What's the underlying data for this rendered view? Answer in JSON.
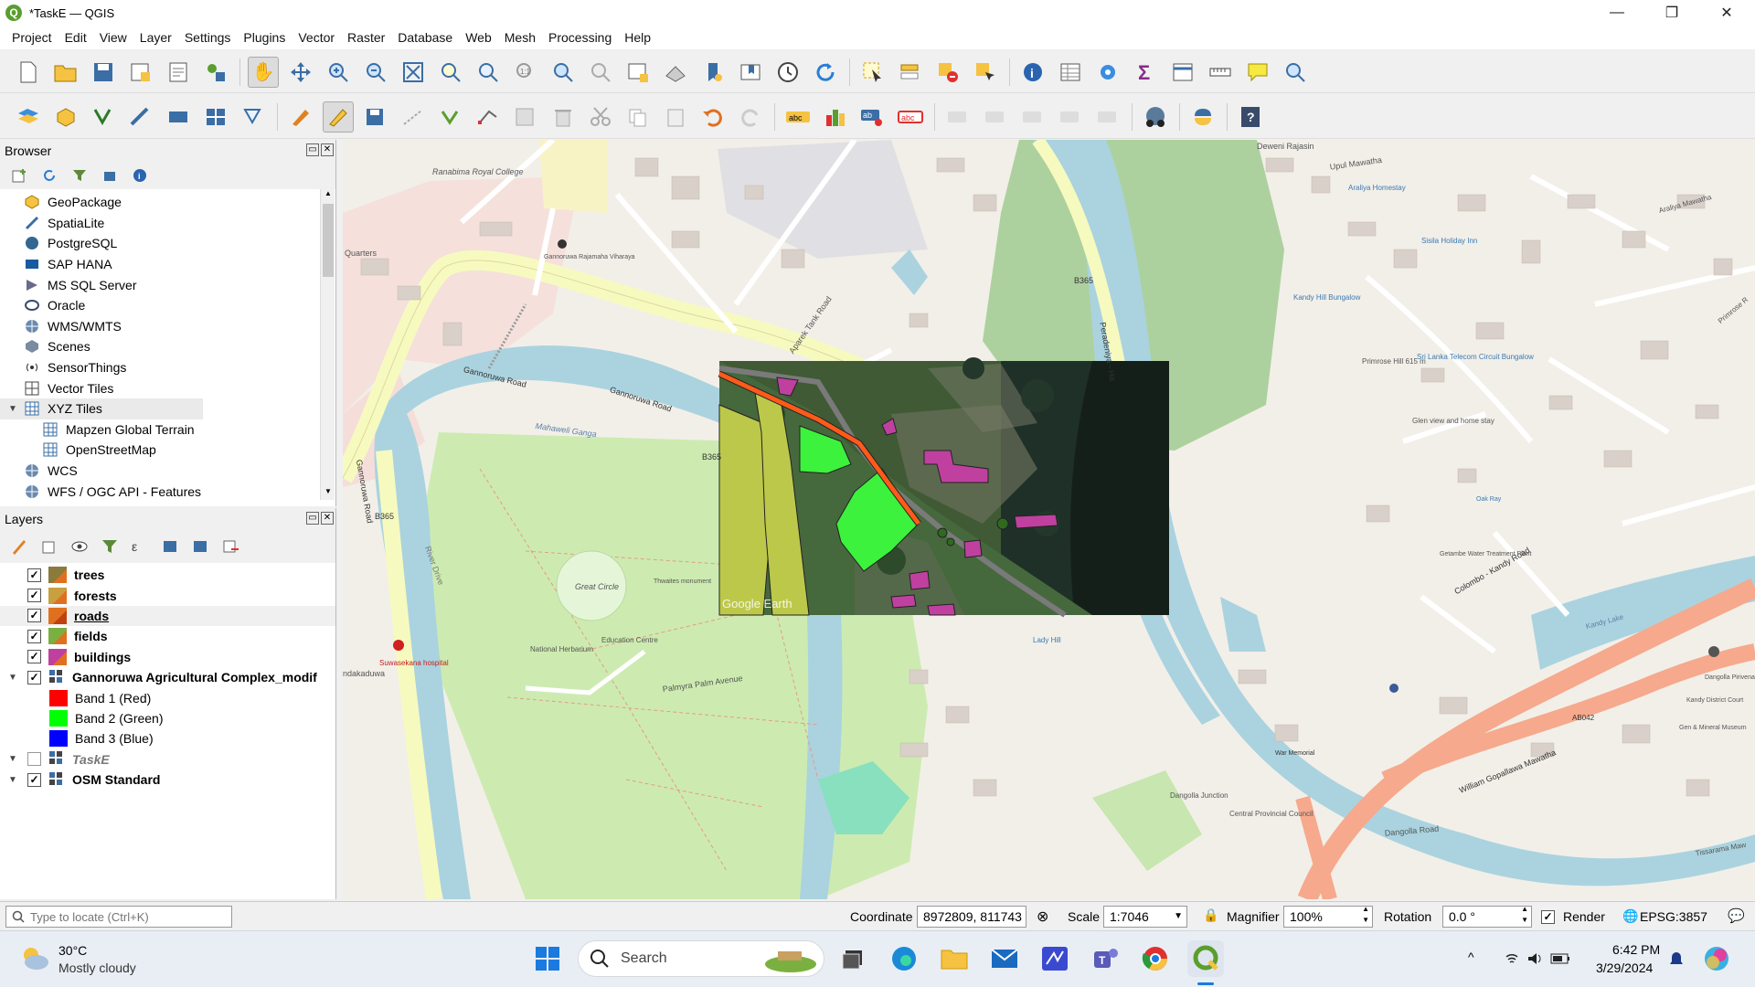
{
  "window": {
    "title": "*TaskE — QGIS",
    "app_icon": "qgis-logo-icon",
    "minimize": "—",
    "maximize": "❐",
    "close": "✕"
  },
  "menu": [
    "Project",
    "Edit",
    "View",
    "Layer",
    "Settings",
    "Plugins",
    "Vector",
    "Raster",
    "Database",
    "Web",
    "Mesh",
    "Processing",
    "Help"
  ],
  "toolbar1": [
    "new-project-icon",
    "open-project-icon",
    "save-project-icon",
    "new-print-layout-icon",
    "layout-manager-icon",
    "style-manager-icon",
    "pan-map-icon",
    "pan-to-selection-icon",
    "zoom-in-icon",
    "zoom-out-icon",
    "zoom-full-icon",
    "zoom-to-selection-icon",
    "zoom-to-layer-icon",
    "zoom-native-icon",
    "zoom-last-icon",
    "zoom-next-icon",
    "new-map-view-icon",
    "new-3d-map-view-icon",
    "new-bookmark-icon",
    "show-bookmarks-icon",
    "temporal-controller-icon",
    "refresh-icon",
    "select-features-icon",
    "select-by-value-icon",
    "deselect-icon",
    "select-by-location-icon",
    "identify-icon",
    "attribute-table-icon",
    "processing-toolbox-icon",
    "statistics-icon",
    "open-field-calculator-icon",
    "measure-icon",
    "map-tips-icon",
    "locate-icon"
  ],
  "toolbar2": [
    "data-source-manager-icon",
    "new-geopackage-layer-icon",
    "new-shapefile-layer-icon",
    "new-spatialite-layer-icon",
    "new-temporary-layer-icon",
    "new-virtual-layer-icon",
    "digitize-icon",
    "toggle-editing-icon",
    "save-edits-icon",
    "add-feature-icon",
    "vertex-tool-icon",
    "modify-attributes-icon",
    "delete-selected-icon",
    "cut-features-icon",
    "copy-features-icon",
    "paste-features-icon",
    "undo-icon",
    "redo-icon",
    "label-tool-icon",
    "diagram-tool-icon",
    "pin-labels-icon",
    "highlight-labels-icon",
    "show-hide-labels-icon",
    "move-label-icon",
    "rotate-label-icon",
    "change-label-icon",
    "quickmapservices-icon",
    "python-console-icon",
    "help-icon"
  ],
  "browser": {
    "title": "Browser",
    "items": [
      {
        "label": "GeoPackage",
        "icon": "geopackage-icon",
        "indent": 1
      },
      {
        "label": "SpatiaLite",
        "icon": "spatialite-icon",
        "indent": 1
      },
      {
        "label": "PostgreSQL",
        "icon": "postgresql-icon",
        "indent": 1
      },
      {
        "label": "SAP HANA",
        "icon": "sap-hana-icon",
        "indent": 1
      },
      {
        "label": "MS SQL Server",
        "icon": "mssql-icon",
        "indent": 1
      },
      {
        "label": "Oracle",
        "icon": "oracle-icon",
        "indent": 1
      },
      {
        "label": "WMS/WMTS",
        "icon": "wms-icon",
        "indent": 1
      },
      {
        "label": "Scenes",
        "icon": "scenes-icon",
        "indent": 1
      },
      {
        "label": "SensorThings",
        "icon": "sensorthings-icon",
        "indent": 1
      },
      {
        "label": "Vector Tiles",
        "icon": "vector-tiles-icon",
        "indent": 1
      },
      {
        "label": "XYZ Tiles",
        "icon": "xyz-tiles-icon",
        "indent": 1,
        "expanded": true
      },
      {
        "label": "Mapzen Global Terrain",
        "icon": "tile-grid-icon",
        "indent": 2
      },
      {
        "label": "OpenStreetMap",
        "icon": "tile-grid-icon",
        "indent": 2
      },
      {
        "label": "WCS",
        "icon": "wcs-icon",
        "indent": 1
      },
      {
        "label": "WFS / OGC API - Features",
        "icon": "wfs-icon",
        "indent": 1
      }
    ]
  },
  "layers": {
    "title": "Layers",
    "items": [
      {
        "label": "trees",
        "checked": true,
        "bold": true,
        "swatch": "#8a7a3c",
        "indent": 1
      },
      {
        "label": "forests",
        "checked": true,
        "bold": true,
        "swatch": "#c8a040",
        "indent": 1
      },
      {
        "label": "roads",
        "checked": true,
        "bold": true,
        "underline": true,
        "swatch": "#e07020",
        "indent": 1
      },
      {
        "label": "fields",
        "checked": true,
        "bold": true,
        "swatch": "#7ab040",
        "indent": 1
      },
      {
        "label": "buildings",
        "checked": true,
        "bold": true,
        "swatch": "#c040a0",
        "indent": 1
      },
      {
        "label": "Gannoruwa Agricultural Complex_modif",
        "checked": true,
        "bold": true,
        "raster": true,
        "expanded": true,
        "indent": 0
      },
      {
        "label": "Band 1 (Red)",
        "band": "#ff0000",
        "indent": 2
      },
      {
        "label": "Band 2 (Green)",
        "band": "#00ff00",
        "indent": 2
      },
      {
        "label": "Band 3 (Blue)",
        "band": "#0000ff",
        "indent": 2
      },
      {
        "label": "TaskE",
        "checked": false,
        "bold": true,
        "italic": true,
        "raster": true,
        "expanded": true,
        "indent": 0
      },
      {
        "label": "OSM Standard",
        "checked": true,
        "bold": true,
        "raster": true,
        "expanded": true,
        "indent": 0
      }
    ]
  },
  "locator": {
    "placeholder": "Type to locate (Ctrl+K)"
  },
  "status": {
    "coordinate_label": "Coordinate",
    "coordinate": "8972809, 811743",
    "scale_label": "Scale",
    "scale": "1:7046",
    "magnifier_label": "Magnifier",
    "magnifier": "100%",
    "rotation_label": "Rotation",
    "rotation": "0.0 °",
    "render_label": "Render",
    "crs": "EPSG:3857"
  },
  "map": {
    "labels": {
      "ranabima": "Ranabima Royal College",
      "quarters": "Quarters",
      "vihara": "Gannoruwa Rajamaha Viharaya",
      "gannoruwa_road1": "Gannoruwa Road",
      "gannoruwa_road2": "Gannoruwa Road",
      "gannoruwa_road3": "Gannoruwa Road",
      "mahaweli": "Mahaweli Ganga",
      "river_drive": "River Drive",
      "great_circle": "Great Circle",
      "thwaites": "Thwaites monument",
      "national_herbarium": "National Herbarium",
      "education": "Education Centre",
      "palmyra": "Palmyra Palm Avenue",
      "suwasekana": "Suwasekana hospital",
      "ndakaduwa": "ndakaduwa",
      "b365a": "B365",
      "b365b": "B365",
      "b365c": "B365",
      "peradeniya": "Peradeniya - Ha",
      "aparek": "Aparek Tank Road",
      "upul": "Upul Mawatha",
      "deweni": "Deweni Rajasin",
      "araliya": "Araliya Homestay",
      "sisila": "Sisila Holiday Inn",
      "kandy_hill": "Kandy Hill Bungalow",
      "primrose": "Primrose Hill 615 m",
      "srilanka_telecom": "Sri Lanka Telecom Circuit Bungalow",
      "glen": "Glen view and home stay",
      "colombo_kandy": "Colombo - Kandy Road",
      "william": "William Gopallawa Mawatha",
      "dangolla_junction": "Dangolla Junction",
      "dangolla_road": "Dangolla Road",
      "central": "Central Provincial Council",
      "ab042": "AB042",
      "getambe": "Getambe Water Treatment Plant",
      "dangolla_pw": "Dangolla Pirivena",
      "kandy_court": "Kandy District Court",
      "lady_hill": "Lady Hill",
      "kandy_lake": "Kandy Lake",
      "araliya_mawatha": "Araliya Mawatha",
      "primrose_road": "Primrose R",
      "tissarama": "Tissarama Maw",
      "google_earth": "Google Earth",
      "oak_ray": "Oak Ray",
      "war_memorial": "War Memorial",
      "gen_museum": "Gen & Mineral Museum"
    }
  },
  "taskbar": {
    "weather_temp": "30°C",
    "weather_desc": "Mostly cloudy",
    "search_label": "Search",
    "time": "6:42 PM",
    "date": "3/29/2024",
    "apps": [
      "windows-start-icon",
      "file-manager-icon",
      "edge-icon",
      "folder-icon",
      "mail-icon",
      "vscode-icon",
      "teams-icon",
      "chrome-icon",
      "qgis-taskbar-icon"
    ]
  }
}
